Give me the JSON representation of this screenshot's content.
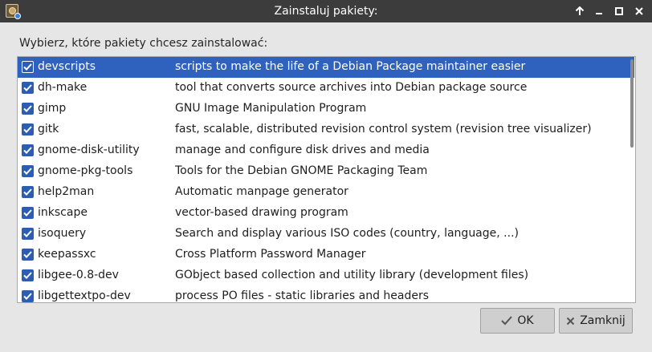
{
  "window": {
    "title": "Zainstaluj pakiety:",
    "controls": [
      "keep-above",
      "minimize",
      "maximize",
      "close"
    ]
  },
  "prompt": "Wybierz, które pakiety chcesz zainstalować:",
  "packages": [
    {
      "name": "devscripts",
      "description": "scripts to make the life of a Debian Package maintainer easier",
      "checked": true,
      "selected": true
    },
    {
      "name": "dh-make",
      "description": "tool that converts source archives into Debian package source",
      "checked": true,
      "selected": false
    },
    {
      "name": "gimp",
      "description": "GNU Image Manipulation Program",
      "checked": true,
      "selected": false
    },
    {
      "name": "gitk",
      "description": "fast, scalable, distributed revision control system (revision tree visualizer)",
      "checked": true,
      "selected": false
    },
    {
      "name": "gnome-disk-utility",
      "description": "manage and configure disk drives and media",
      "checked": true,
      "selected": false
    },
    {
      "name": "gnome-pkg-tools",
      "description": "Tools for the Debian GNOME Packaging Team",
      "checked": true,
      "selected": false
    },
    {
      "name": "help2man",
      "description": "Automatic manpage generator",
      "checked": true,
      "selected": false
    },
    {
      "name": "inkscape",
      "description": "vector-based drawing program",
      "checked": true,
      "selected": false
    },
    {
      "name": "isoquery",
      "description": "Search and display various ISO codes (country, language, ...)",
      "checked": true,
      "selected": false
    },
    {
      "name": "keepassxc",
      "description": "Cross Platform Password Manager",
      "checked": true,
      "selected": false
    },
    {
      "name": "libgee-0.8-dev",
      "description": "GObject based collection and utility library (development files)",
      "checked": true,
      "selected": false
    },
    {
      "name": "libgettextpo-dev",
      "description": "process PO files - static libraries and headers",
      "checked": true,
      "selected": false
    }
  ],
  "buttons": {
    "ok_label": "OK",
    "ok_icon": "check-icon",
    "close_label": "Zamknij",
    "close_icon": "x-icon"
  },
  "colors": {
    "selection": "#2f62bf",
    "checkbox": "#2c5db5",
    "titlebar": "#3c3c3c"
  }
}
